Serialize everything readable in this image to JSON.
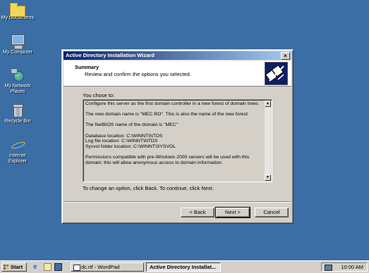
{
  "desktop": {
    "icons": [
      {
        "label": "My Documents",
        "icon": "folder-icon"
      },
      {
        "label": "My Computer",
        "icon": "computer-icon"
      },
      {
        "label_line1": "My Network",
        "label_line2": "Places",
        "icon": "network-places-icon"
      },
      {
        "label": "Recycle Bin",
        "icon": "recycle-bin-icon"
      },
      {
        "label_line1": "Internet",
        "label_line2": "Explorer",
        "icon": "internet-explorer-icon"
      }
    ],
    "background_color": "#3a6ea5"
  },
  "dialog": {
    "title": "Active Directory Installation Wizard",
    "close_glyph": "×",
    "header_title": "Summary",
    "header_subtitle": "Review and confirm the options you selected.",
    "you_chose_label": "You chose to:",
    "summary_paragraphs": [
      "Configure this server as the first domain controller in a new forest of domain trees.",
      "The new domain name is \"MEC.RO\".  This is also the name of the new forest.",
      "The NetBIOS name of the domain is \"MEC\"",
      "Database location: C:\\WINNT\\NTDS\nLog file location: C:\\WINNT\\NTDS\nSysvol folder location: C:\\WINNT\\SYSVOL",
      "Permissions compatible with pre-Windows 2000 servers will be used with this domain; this will allow anonymous access to domain information."
    ],
    "instruction": "To change an option, click Back. To continue, click Next.",
    "buttons": {
      "back": "< Back",
      "next": "Next >",
      "cancel": "Cancel"
    },
    "title_gradient": [
      "#0a246a",
      "#a6caf0"
    ]
  },
  "taskbar": {
    "start_label": "Start",
    "tasks": [
      {
        "label": "dc.rtf - WordPad",
        "active": false
      },
      {
        "label": "Active Directory Installat...",
        "active": true
      }
    ],
    "clock": "10:00 AM"
  }
}
